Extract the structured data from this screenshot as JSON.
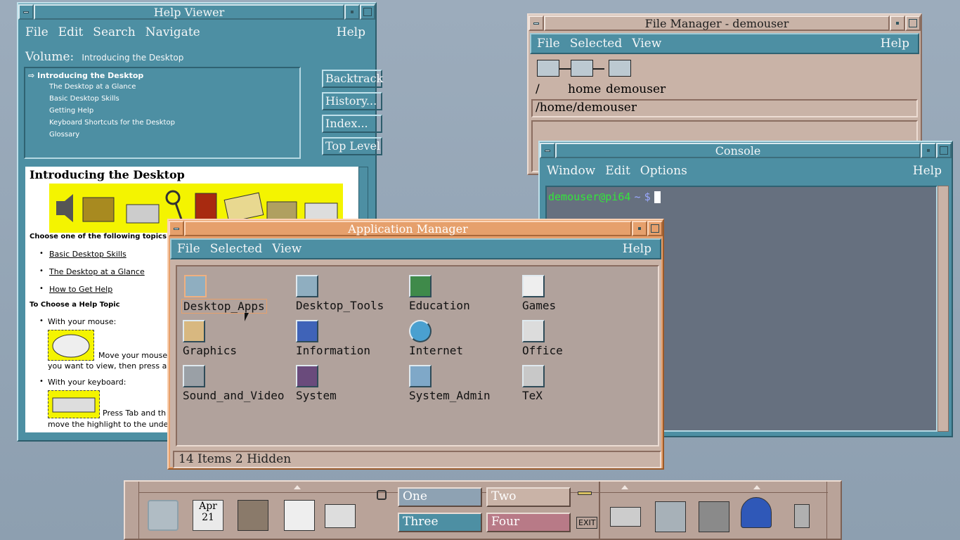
{
  "help_viewer": {
    "title": "Help Viewer",
    "menus": [
      "File",
      "Edit",
      "Search",
      "Navigate"
    ],
    "help": "Help",
    "volume_label": "Volume:",
    "volume_value": "Introducing the Desktop",
    "topics": [
      "Introducing the Desktop",
      "The Desktop at a Glance",
      "Basic Desktop Skills",
      "Getting Help",
      "Keyboard Shortcuts for the Desktop",
      "Glossary"
    ],
    "buttons": [
      "Backtrack",
      "History...",
      "Index...",
      "Top Level"
    ],
    "content": {
      "heading": "Introducing the Desktop",
      "choose": "Choose one of the following topics:",
      "links": [
        "Basic Desktop Skills",
        "The Desktop at a Glance",
        "How to Get Help"
      ],
      "subheading": "To Choose a Help Topic",
      "mouse_label": "With your mouse:",
      "mouse_text1": "Move your mouse",
      "mouse_text2": "you want to view, then press a",
      "kbd_label": "With your keyboard:",
      "kbd_text1": "Press Tab and th",
      "kbd_text2": "move the highlight to the unde"
    }
  },
  "file_manager": {
    "title": "File Manager - demouser",
    "menus": [
      "File",
      "Selected",
      "View"
    ],
    "help": "Help",
    "path_root": "/",
    "path_home": "home",
    "path_user": "demouser",
    "path_field": "/home/demouser"
  },
  "console": {
    "title": "Console",
    "menus": [
      "Window",
      "Edit",
      "Options"
    ],
    "help": "Help",
    "prompt_user": "demouser@pi64",
    "prompt_tilde": "~",
    "prompt_sign": "$"
  },
  "app_manager": {
    "title": "Application Manager",
    "menus": [
      "File",
      "Selected",
      "View"
    ],
    "help": "Help",
    "items": [
      "Desktop_Apps",
      "Desktop_Tools",
      "Education",
      "Games",
      "Graphics",
      "Information",
      "Internet",
      "Office",
      "Sound_and_Video",
      "System",
      "System_Admin",
      "TeX"
    ],
    "status": "14 Items 2 Hidden"
  },
  "panel": {
    "date_month": "Apr",
    "date_day": "21",
    "workspaces": [
      "One",
      "Two",
      "Three",
      "Four"
    ],
    "exit": "EXIT"
  }
}
